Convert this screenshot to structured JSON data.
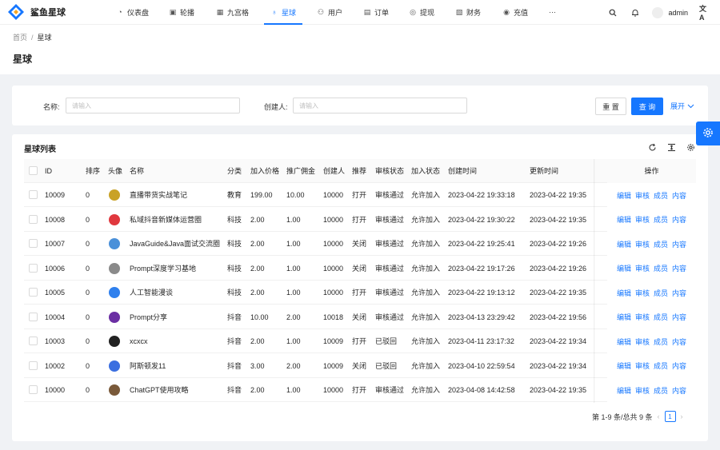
{
  "app": {
    "name": "鲨鱼星球",
    "brand_color": "#1677ff"
  },
  "nav": {
    "items": [
      {
        "label": "仪表盘",
        "icon": "dashboard-icon"
      },
      {
        "label": "轮播",
        "icon": "picture-icon"
      },
      {
        "label": "九宫格",
        "icon": "grid-icon"
      },
      {
        "label": "星球",
        "icon": "planet-icon",
        "active": true
      },
      {
        "label": "用户",
        "icon": "user-icon"
      },
      {
        "label": "订单",
        "icon": "order-icon"
      },
      {
        "label": "提现",
        "icon": "withdraw-icon"
      },
      {
        "label": "财务",
        "icon": "finance-icon"
      },
      {
        "label": "充值",
        "icon": "recharge-icon"
      }
    ],
    "more": "···",
    "user": "admin"
  },
  "breadcrumb": {
    "home": "首页",
    "sep": "/",
    "current": "星球"
  },
  "page_title": "星球",
  "search": {
    "name_label": "名称:",
    "name_placeholder": "请输入",
    "creator_label": "创建人:",
    "creator_placeholder": "请输入",
    "reset": "重 置",
    "query": "查 询",
    "expand": "展开"
  },
  "list": {
    "title": "星球列表",
    "columns": [
      "ID",
      "排序",
      "头像",
      "名称",
      "分类",
      "加入价格",
      "推广佣金",
      "创建人",
      "推荐",
      "审核状态",
      "加入状态",
      "创建时间",
      "更新时间",
      "操作"
    ],
    "rows": [
      {
        "id": "10009",
        "sort": "0",
        "avatar": "#c9a227",
        "name": "直播带货实战笔记",
        "cat": "教育",
        "price": "199.00",
        "comm": "10.00",
        "creator": "10000",
        "rec": "打开",
        "audit": "审核通过",
        "join": "允许加入",
        "created": "2023-04-22 19:33:18",
        "updated": "2023-04-22 19:35"
      },
      {
        "id": "10008",
        "sort": "0",
        "avatar": "#e0383e",
        "name": "私域抖音新媒体运营圈",
        "cat": "科技",
        "price": "2.00",
        "comm": "1.00",
        "creator": "10000",
        "rec": "打开",
        "audit": "审核通过",
        "join": "允许加入",
        "created": "2023-04-22 19:30:22",
        "updated": "2023-04-22 19:35"
      },
      {
        "id": "10007",
        "sort": "0",
        "avatar": "#4a90d9",
        "name": "JavaGuide&Java面试交流圈",
        "cat": "科技",
        "price": "2.00",
        "comm": "1.00",
        "creator": "10000",
        "rec": "关闭",
        "audit": "审核通过",
        "join": "允许加入",
        "created": "2023-04-22 19:25:41",
        "updated": "2023-04-22 19:26"
      },
      {
        "id": "10006",
        "sort": "0",
        "avatar": "#8a8a8a",
        "name": "Prompt深度学习基地",
        "cat": "科技",
        "price": "2.00",
        "comm": "1.00",
        "creator": "10000",
        "rec": "关闭",
        "audit": "审核通过",
        "join": "允许加入",
        "created": "2023-04-22 19:17:26",
        "updated": "2023-04-22 19:26"
      },
      {
        "id": "10005",
        "sort": "0",
        "avatar": "#2f80ed",
        "name": "人工智能漫谈",
        "cat": "科技",
        "price": "2.00",
        "comm": "1.00",
        "creator": "10000",
        "rec": "打开",
        "audit": "审核通过",
        "join": "允许加入",
        "created": "2023-04-22 19:13:12",
        "updated": "2023-04-22 19:35"
      },
      {
        "id": "10004",
        "sort": "0",
        "avatar": "#6b2fa3",
        "name": "Prompt分享",
        "cat": "抖音",
        "price": "10.00",
        "comm": "2.00",
        "creator": "10018",
        "rec": "关闭",
        "audit": "审核通过",
        "join": "允许加入",
        "created": "2023-04-13 23:29:42",
        "updated": "2023-04-22 19:56"
      },
      {
        "id": "10003",
        "sort": "0",
        "avatar": "#222222",
        "name": "xcxcx",
        "cat": "抖音",
        "price": "2.00",
        "comm": "1.00",
        "creator": "10009",
        "rec": "打开",
        "audit": "已驳回",
        "join": "允许加入",
        "created": "2023-04-11 23:17:32",
        "updated": "2023-04-22 19:34"
      },
      {
        "id": "10002",
        "sort": "0",
        "avatar": "#3b6fe0",
        "name": "阿斯顿发11",
        "cat": "抖音",
        "price": "3.00",
        "comm": "2.00",
        "creator": "10009",
        "rec": "关闭",
        "audit": "已驳回",
        "join": "允许加入",
        "created": "2023-04-10 22:59:54",
        "updated": "2023-04-22 19:34"
      },
      {
        "id": "10000",
        "sort": "0",
        "avatar": "#7a5a3a",
        "name": "ChatGPT使用攻略",
        "cat": "抖音",
        "price": "2.00",
        "comm": "1.00",
        "creator": "10000",
        "rec": "打开",
        "audit": "审核通过",
        "join": "允许加入",
        "created": "2023-04-08 14:42:58",
        "updated": "2023-04-22 19:35"
      }
    ],
    "actions": [
      "编辑",
      "审核",
      "成员",
      "内容"
    ]
  },
  "pagination": {
    "summary": "第 1-9 条/总共 9 条",
    "current": "1"
  }
}
